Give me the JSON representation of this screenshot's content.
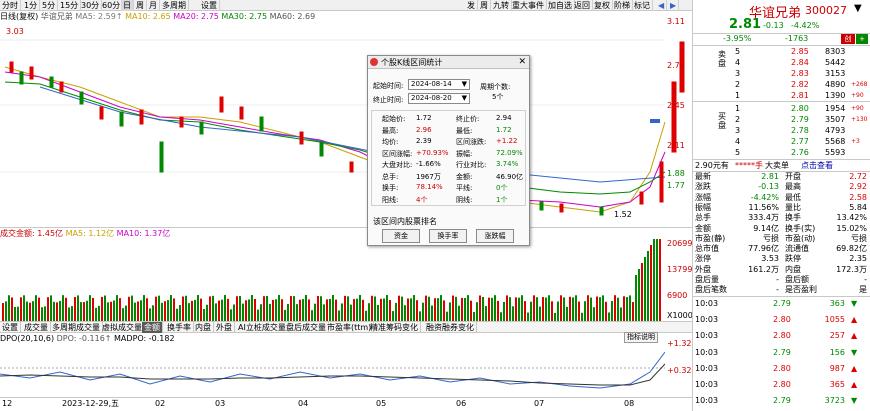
{
  "toolbar": {
    "items": [
      "分时",
      "1分",
      "5分",
      "15分",
      "30分",
      "60分",
      "日",
      "周",
      "月",
      "多周期",
      "设置"
    ],
    "right_items": [
      "发",
      "周",
      "九转",
      "重大事件",
      "加自选",
      "返回",
      "复权",
      "阶梯",
      "标记"
    ],
    "active_index": 6
  },
  "main_legend": {
    "label": "日线(复权)",
    "stock": "华谊兄弟",
    "ma5": "MA5: 2.59↑",
    "ma10": "MA10: 2.65",
    "ma20": "MA20: 2.75",
    "ma30": "MA30: 2.75",
    "ma60": "MA60: 2.69"
  },
  "price_axis": [
    "3.11",
    "2.78",
    "2.45",
    "2.11",
    "1.88",
    "1.77",
    "1.52"
  ],
  "annotations": {
    "high_label": "3.03",
    "low_label": "1.52"
  },
  "volume_legend": {
    "label": "成交金额: 1.45亿",
    "ma5": "MA5: 1.12亿",
    "ma10": "MA10: 1.37亿"
  },
  "volume_axis": [
    "20699",
    "13799",
    "6900",
    "X1000"
  ],
  "tabs": [
    "设置",
    "成交量",
    "多周期成交量",
    "虚拟成交量",
    "金额",
    "换手率",
    "内盘",
    "外盘",
    "AI立桩成交量",
    "盘后成交量",
    "市盈率(ttm)",
    "精准筹码变化",
    "融资融券变化"
  ],
  "active_tab": 4,
  "dpo_legend": {
    "label": "DPO(20,10,6)",
    "dpo": "DPO: -0.116↑",
    "madpo": "MADPO: -0.182",
    "button": "指标说明"
  },
  "dpo_axis": [
    "+1.32",
    "+0.320"
  ],
  "x_axis": [
    "12",
    "2023-12-29,五",
    "02",
    "03",
    "04",
    "05",
    "06",
    "07",
    "08"
  ],
  "dialog": {
    "title": "个股K线区间统计",
    "start_label": "起始时间:",
    "start_value": "2024-08-14",
    "end_label": "终止时间:",
    "end_value": "2024-08-20",
    "period_label": "周期个数:",
    "period_value": "5个",
    "stats": [
      {
        "l1": "起始价:",
        "v1": "1.72",
        "l2": "终止价:",
        "v2": "2.94"
      },
      {
        "l1": "最高:",
        "v1": "2.96",
        "l2": "最低:",
        "v2": "1.72"
      },
      {
        "l1": "均价:",
        "v1": "2.39",
        "l2": "区间涨跌:",
        "v2": "+1.22"
      },
      {
        "l1": "区间涨幅:",
        "v1": "+70.93%",
        "l2": "振幅:",
        "v2": "72.09%"
      },
      {
        "l1": "大盘对比:",
        "v1": "-1.66%",
        "l2": "行业对比:",
        "v2": "3.74%"
      },
      {
        "l1": "总手:",
        "v1": "1967万",
        "l2": "金额:",
        "v2": "46.90亿"
      },
      {
        "l1": "换手:",
        "v1": "78.14%",
        "l2": "平线:",
        "v2": "0个"
      },
      {
        "l1": "阳线:",
        "v1": "4个",
        "l2": "阴线:",
        "v2": "1个"
      }
    ],
    "rank_label": "该区间内股票排名",
    "buttons": [
      "资金",
      "换手率",
      "涨跌幅"
    ]
  },
  "quote": {
    "name": "华谊兄弟",
    "code": "300027",
    "price": "2.81",
    "change": "-0.13",
    "change_pct": "-4.42%",
    "sub_left": "-3.95%",
    "sub_mid": "-1763",
    "tag": "创",
    "sell_label": "卖盘",
    "buy_label": "买盘",
    "sells": [
      {
        "n": "5",
        "p": "2.85",
        "v": "8303",
        "d": ""
      },
      {
        "n": "4",
        "p": "2.84",
        "v": "5442",
        "d": ""
      },
      {
        "n": "3",
        "p": "2.83",
        "v": "3153",
        "d": ""
      },
      {
        "n": "2",
        "p": "2.82",
        "v": "4890",
        "d": "+268"
      },
      {
        "n": "1",
        "p": "2.81",
        "v": "1390",
        "d": "+90"
      }
    ],
    "buys": [
      {
        "n": "1",
        "p": "2.80",
        "v": "1954",
        "d": "+90"
      },
      {
        "n": "2",
        "p": "2.79",
        "v": "3507",
        "d": "+130"
      },
      {
        "n": "3",
        "p": "2.78",
        "v": "4793",
        "d": ""
      },
      {
        "n": "4",
        "p": "2.77",
        "v": "5568",
        "d": "+3"
      },
      {
        "n": "5",
        "p": "2.76",
        "v": "5593",
        "d": ""
      }
    ],
    "yuan_bar": {
      "a": "2.90元有",
      "b": "*****手",
      "c": "大卖单",
      "d": "点击查看"
    },
    "stats": [
      {
        "l1": "最新",
        "v1": "2.81",
        "l2": "开盘",
        "v2": "2.72"
      },
      {
        "l1": "涨跌",
        "v1": "-0.13",
        "l2": "最高",
        "v2": "2.92"
      },
      {
        "l1": "涨幅",
        "v1": "-4.42%",
        "l2": "最低",
        "v2": "2.58"
      },
      {
        "l1": "振幅",
        "v1": "11.56%",
        "l2": "量比",
        "v2": "5.84"
      },
      {
        "l1": "总手",
        "v1": "333.4万",
        "l2": "换手",
        "v2": "13.42%"
      },
      {
        "l1": "金额",
        "v1": "9.14亿",
        "l2": "换手(实)",
        "v2": "15.02%"
      },
      {
        "l1": "市盈(静)",
        "v1": "亏损",
        "l2": "市盈(动)",
        "v2": "亏损"
      },
      {
        "l1": "总市值",
        "v1": "77.96亿",
        "l2": "流通值",
        "v2": "69.82亿"
      },
      {
        "l1": "涨停",
        "v1": "3.53",
        "l2": "跌停",
        "v2": "2.35"
      },
      {
        "l1": "外盘",
        "v1": "161.2万",
        "l2": "内盘",
        "v2": "172.3万"
      },
      {
        "l1": "盘后量",
        "v1": "-",
        "l2": "盘后额",
        "v2": "-"
      },
      {
        "l1": "盘后笔数",
        "v1": "-",
        "l2": "是否盈利",
        "v2": "是"
      }
    ],
    "ticks": [
      {
        "t": "10:03",
        "p": "2.79",
        "v": "363",
        "d": "down"
      },
      {
        "t": "10:03",
        "p": "2.80",
        "v": "1055",
        "d": "up"
      },
      {
        "t": "10:03",
        "p": "2.80",
        "v": "257",
        "d": "up"
      },
      {
        "t": "10:03",
        "p": "2.79",
        "v": "156",
        "d": "down"
      },
      {
        "t": "10:03",
        "p": "2.80",
        "v": "987",
        "d": "up"
      },
      {
        "t": "10:03",
        "p": "2.80",
        "v": "365",
        "d": "up"
      },
      {
        "t": "10:03",
        "p": "2.79",
        "v": "3723",
        "d": "down"
      }
    ]
  }
}
